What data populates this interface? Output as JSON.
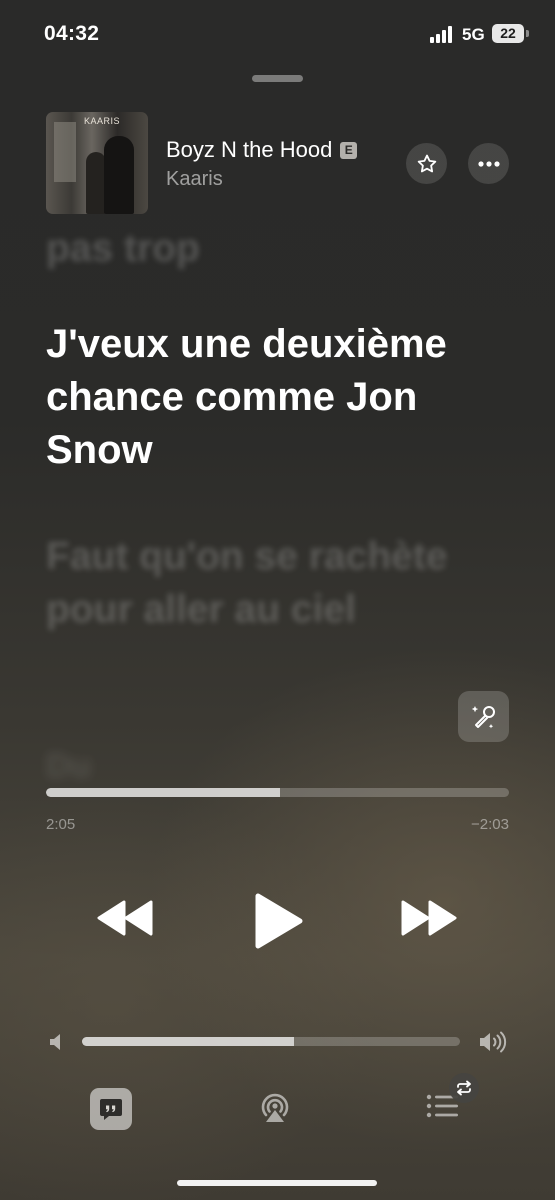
{
  "status_bar": {
    "time": "04:32",
    "network": "5G",
    "battery": "22"
  },
  "now_playing": {
    "title": "Boyz N the Hood",
    "explicit_badge": "E",
    "artist": "Kaaris",
    "artwork_text": "KAARIS"
  },
  "lyrics": {
    "previous": "pas trop",
    "current": "J'veux une deuxième chance comme Jon Snow",
    "next": "Faut qu'on se rachète pour aller au ciel",
    "after_next": "Du"
  },
  "playback": {
    "elapsed": "2:05",
    "remaining": "−2:03",
    "progress_fraction": 0.505
  },
  "volume": {
    "level_fraction": 0.56
  },
  "icons": {
    "star": "star-icon",
    "more": "ellipsis-icon",
    "sing": "microphone-sparkles-icon",
    "rewind": "backward-icon",
    "play": "play-icon",
    "forward": "forward-icon",
    "volume_low": "speaker-icon",
    "volume_high": "speaker-wave-icon",
    "lyrics": "quote-bubble-icon",
    "airplay": "airplay-audio-icon",
    "queue": "list-icon",
    "repeat": "repeat-icon"
  }
}
